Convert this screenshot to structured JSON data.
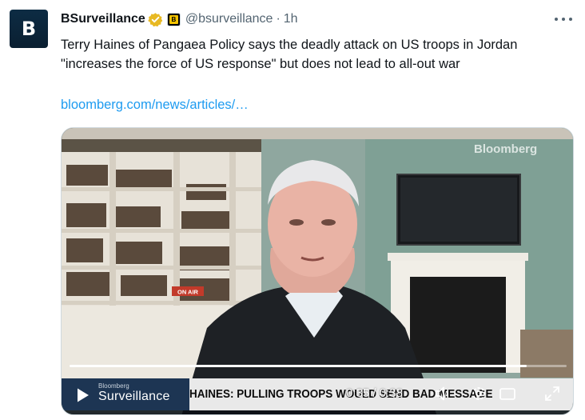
{
  "author": {
    "display_name": "BSurveillance",
    "handle": "@bsurveillance",
    "separator": "·",
    "time": "1h",
    "avatar_letter": "B",
    "verified_color": "#e8b923",
    "affiliation_badge_color": "#f5c400"
  },
  "tweet": {
    "text": "Terry Haines of Pangaea Policy says the deadly attack on US troops in Jordan \"increases the force of US response\" but does not lead to all-out war",
    "link": "bloomberg.com/news/articles/…"
  },
  "video": {
    "watermark": "Bloomberg",
    "show_brand_top": "Bloomberg",
    "show_brand_main": "Surveillance",
    "headline": "HAINES: PULLING TROOPS WOULD SEND BAD MESSAGE",
    "studio_sign": "ON AIR",
    "time_current": "0:35",
    "time_separator": "/",
    "time_total": "0:38",
    "time_readout": "0:35 / 0:38",
    "progress_fraction": 0.92
  },
  "icons": {
    "more": "more-icon",
    "verified": "verified-badge-icon",
    "affiliate": "bloomberg-affiliate-icon",
    "play": "play-icon",
    "volume": "volume-icon",
    "settings": "settings-icon",
    "fullscreen": "fullscreen-icon"
  },
  "colors": {
    "link": "#1d9bf0",
    "secondary_text": "#536471",
    "primary_text": "#0f1419"
  }
}
